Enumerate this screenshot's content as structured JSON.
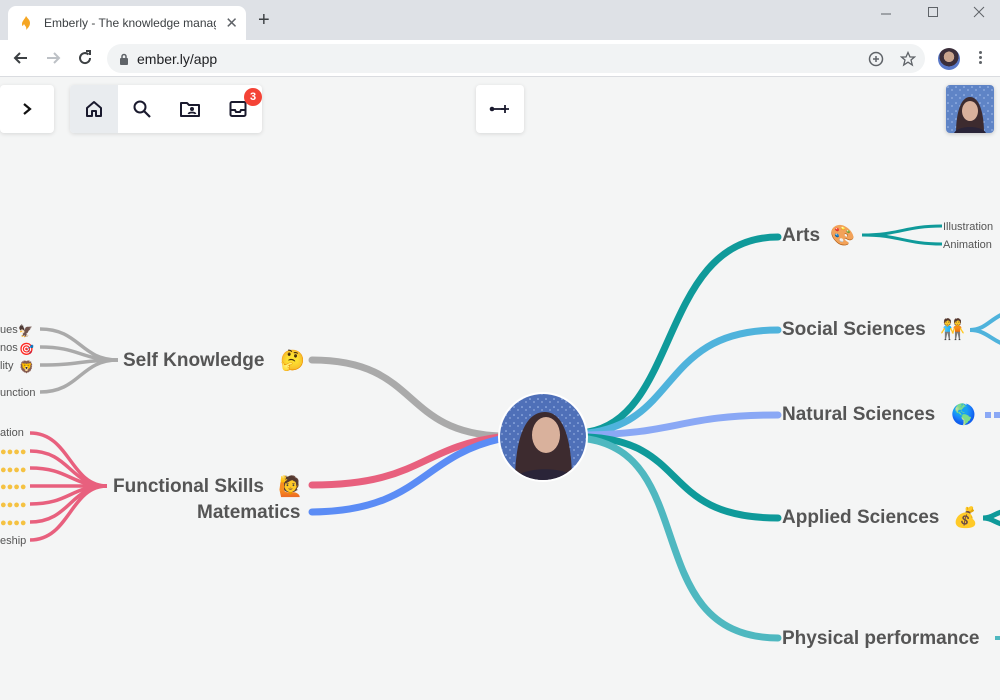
{
  "browser": {
    "tab_title": "Emberly - The knowledge manag",
    "url": "ember.ly/app",
    "new_tab_label": "+",
    "close_label": "✕"
  },
  "app": {
    "inbox_badge": "3",
    "nav_items": [
      "home-icon",
      "search-icon",
      "folder-person-icon",
      "inbox-icon"
    ]
  },
  "mindmap": {
    "center": "avatar",
    "right_nodes": [
      {
        "label": "Arts",
        "emoji": "🎨",
        "color": "#0f9a9a",
        "children": [
          "Illustration",
          "Animation"
        ]
      },
      {
        "label": "Social Sciences",
        "emoji": "🧑‍🤝‍🧑",
        "color": "#4fb3dc"
      },
      {
        "label": "Natural Sciences",
        "emoji": "🌎",
        "color": "#8aa8f5"
      },
      {
        "label": "Applied Sciences",
        "emoji": "💰",
        "color": "#0f9a9a"
      },
      {
        "label": "Physical performance",
        "emoji": "",
        "color": "#4fb8c0"
      }
    ],
    "left_nodes": [
      {
        "label": "Self Knowledge",
        "emoji": "🤔",
        "color": "#aaaaaa",
        "children": [
          "ues",
          "nos",
          "lity",
          "unction"
        ],
        "child_emojis": [
          "🦅",
          "🎯",
          "🦁",
          ""
        ]
      },
      {
        "label": "Functional Skills",
        "emoji": "🙋",
        "color": "#e8607e",
        "children": [
          "ation",
          "●●●●",
          "●●●●",
          "●●●●",
          "●●●●",
          "●●●●",
          "eship"
        ]
      },
      {
        "label": "Matematics",
        "emoji": "",
        "color": "#5b8cf5"
      }
    ]
  }
}
